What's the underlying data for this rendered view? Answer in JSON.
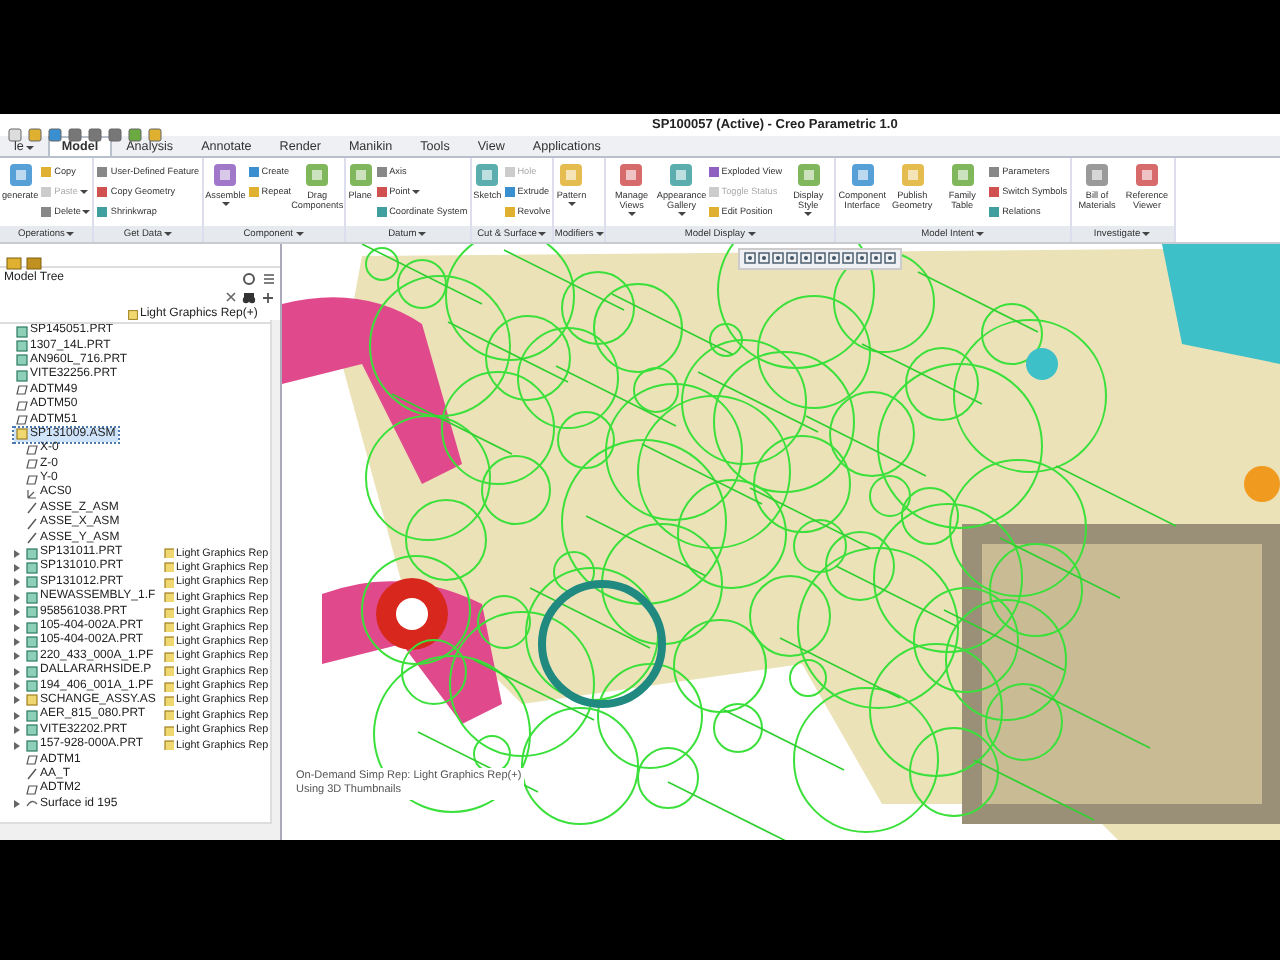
{
  "window": {
    "title": "SP100057 (Active) - Creo Parametric 1.0"
  },
  "tabs": [
    {
      "label": "le",
      "selected": false,
      "has_menu": true
    },
    {
      "label": "Model",
      "selected": true,
      "has_menu": false
    },
    {
      "label": "Analysis",
      "selected": false,
      "has_menu": false
    },
    {
      "label": "Annotate",
      "selected": false,
      "has_menu": false
    },
    {
      "label": "Render",
      "selected": false,
      "has_menu": false
    },
    {
      "label": "Manikin",
      "selected": false,
      "has_menu": false
    },
    {
      "label": "Tools",
      "selected": false,
      "has_menu": false
    },
    {
      "label": "View",
      "selected": false,
      "has_menu": false
    },
    {
      "label": "Applications",
      "selected": false,
      "has_menu": false
    }
  ],
  "ribbon": {
    "groups": [
      {
        "label": "Operations",
        "commands": [
          {
            "label": "generate",
            "kind": "big",
            "disabled": false,
            "has_menu": false
          },
          {
            "label": "Copy",
            "kind": "small",
            "disabled": false,
            "has_menu": false
          },
          {
            "label": "Paste",
            "kind": "small",
            "disabled": true,
            "has_menu": true
          },
          {
            "label": "Delete",
            "kind": "small",
            "disabled": false,
            "has_menu": true
          }
        ]
      },
      {
        "label": "Get Data",
        "commands": [
          {
            "label": "User-Defined Feature",
            "kind": "small",
            "disabled": false,
            "has_menu": false
          },
          {
            "label": "Copy Geometry",
            "kind": "small",
            "disabled": false,
            "has_menu": false
          },
          {
            "label": "Shrinkwrap",
            "kind": "small",
            "disabled": false,
            "has_menu": false
          }
        ]
      },
      {
        "label": "Component",
        "commands": [
          {
            "label": "Assemble",
            "kind": "big",
            "disabled": false,
            "has_menu": true
          },
          {
            "label": "Create",
            "kind": "small",
            "disabled": false,
            "has_menu": false
          },
          {
            "label": "Repeat",
            "kind": "small",
            "disabled": false,
            "has_menu": false
          },
          {
            "label": "Drag Components",
            "kind": "big",
            "disabled": false,
            "has_menu": false
          }
        ]
      },
      {
        "label": "Datum",
        "commands": [
          {
            "label": "Plane",
            "kind": "big",
            "disabled": false,
            "has_menu": false
          },
          {
            "label": "Axis",
            "kind": "small",
            "disabled": false,
            "has_menu": false
          },
          {
            "label": "Point",
            "kind": "small",
            "disabled": false,
            "has_menu": true
          },
          {
            "label": "Coordinate System",
            "kind": "small",
            "disabled": false,
            "has_menu": false
          }
        ]
      },
      {
        "label": "Cut & Surface",
        "commands": [
          {
            "label": "Sketch",
            "kind": "big",
            "disabled": false,
            "has_menu": false
          },
          {
            "label": "Hole",
            "kind": "small",
            "disabled": true,
            "has_menu": false
          },
          {
            "label": "Extrude",
            "kind": "small",
            "disabled": false,
            "has_menu": false
          },
          {
            "label": "Revolve",
            "kind": "small",
            "disabled": false,
            "has_menu": false
          }
        ]
      },
      {
        "label": "Modifiers",
        "commands": [
          {
            "label": "Pattern",
            "kind": "big",
            "disabled": false,
            "has_menu": true
          }
        ]
      },
      {
        "label": "Model Display",
        "commands": [
          {
            "label": "Manage Views",
            "kind": "big",
            "disabled": false,
            "has_menu": true
          },
          {
            "label": "Appearance Gallery",
            "kind": "big",
            "disabled": false,
            "has_menu": true
          },
          {
            "label": "Exploded View",
            "kind": "small",
            "disabled": false,
            "has_menu": false
          },
          {
            "label": "Toggle Status",
            "kind": "small",
            "disabled": true,
            "has_menu": false
          },
          {
            "label": "Edit Position",
            "kind": "small",
            "disabled": false,
            "has_menu": false
          },
          {
            "label": "Display Style",
            "kind": "big",
            "disabled": false,
            "has_menu": true
          }
        ]
      },
      {
        "label": "Model Intent",
        "commands": [
          {
            "label": "Component Interface",
            "kind": "big",
            "disabled": false,
            "has_menu": false
          },
          {
            "label": "Publish Geometry",
            "kind": "big",
            "disabled": false,
            "has_menu": false
          },
          {
            "label": "Family Table",
            "kind": "big",
            "disabled": false,
            "has_menu": false
          },
          {
            "label": "Parameters",
            "kind": "small",
            "disabled": false,
            "has_menu": false
          },
          {
            "label": "Switch Symbols",
            "kind": "small",
            "disabled": false,
            "has_menu": false
          },
          {
            "label": "Relations",
            "kind": "small",
            "disabled": false,
            "has_menu": false
          }
        ]
      },
      {
        "label": "Investigate",
        "commands": [
          {
            "label": "Bill of Materials",
            "kind": "big",
            "disabled": false,
            "has_menu": false
          },
          {
            "label": "Reference Viewer",
            "kind": "big",
            "disabled": false,
            "has_menu": false
          }
        ]
      }
    ]
  },
  "model_tree": {
    "title": "Model Tree",
    "column": "Light Graphics Rep(+)",
    "items": [
      {
        "label": "SP145051.PRT",
        "kind": "part",
        "expandable": false,
        "selected": false
      },
      {
        "label": "1307_14L.PRT",
        "kind": "part",
        "expandable": false,
        "selected": false
      },
      {
        "label": "AN960L_716.PRT",
        "kind": "part",
        "expandable": false,
        "selected": false
      },
      {
        "label": "VITE32256.PRT",
        "kind": "part",
        "expandable": false,
        "selected": false
      },
      {
        "label": "ADTM49",
        "kind": "plane",
        "expandable": false,
        "selected": false
      },
      {
        "label": "ADTM50",
        "kind": "plane",
        "expandable": false,
        "selected": false
      },
      {
        "label": "ADTM51",
        "kind": "plane",
        "expandable": false,
        "selected": false
      },
      {
        "label": "SP131009.ASM",
        "kind": "assembly",
        "expandable": false,
        "selected": true,
        "children": [
          {
            "label": "X-0",
            "kind": "plane",
            "expandable": false,
            "selected": false
          },
          {
            "label": "Z-0",
            "kind": "plane",
            "expandable": false,
            "selected": false
          },
          {
            "label": "Y-0",
            "kind": "plane",
            "expandable": false,
            "selected": false
          },
          {
            "label": "ACS0",
            "kind": "csys",
            "expandable": false,
            "selected": false
          },
          {
            "label": "ASSE_Z_ASM",
            "kind": "axis",
            "expandable": false,
            "selected": false
          },
          {
            "label": "ASSE_X_ASM",
            "kind": "axis",
            "expandable": false,
            "selected": false
          },
          {
            "label": "ASSE_Y_ASM",
            "kind": "axis",
            "expandable": false,
            "selected": false
          },
          {
            "label": "SP131011.PRT",
            "kind": "part",
            "expandable": true,
            "selected": false,
            "rep": "Light Graphics Rep"
          },
          {
            "label": "SP131010.PRT",
            "kind": "part",
            "expandable": true,
            "selected": false,
            "rep": "Light Graphics Rep"
          },
          {
            "label": "SP131012.PRT",
            "kind": "part",
            "expandable": true,
            "selected": false,
            "rep": "Light Graphics Rep"
          },
          {
            "label": "NEWASSEMBLY_1.F",
            "kind": "part",
            "expandable": true,
            "selected": false,
            "rep": "Light Graphics Rep"
          },
          {
            "label": "958561038.PRT",
            "kind": "part",
            "expandable": true,
            "selected": false,
            "rep": "Light Graphics Rep"
          },
          {
            "label": "105-404-002A.PRT",
            "kind": "part",
            "expandable": true,
            "selected": false,
            "rep": "Light Graphics Rep"
          },
          {
            "label": "105-404-002A.PRT",
            "kind": "part",
            "expandable": true,
            "selected": false,
            "rep": "Light Graphics Rep"
          },
          {
            "label": "220_433_000A_1.PF",
            "kind": "part",
            "expandable": true,
            "selected": false,
            "rep": "Light Graphics Rep"
          },
          {
            "label": "DALLARARHSIDE.P",
            "kind": "part",
            "expandable": true,
            "selected": false,
            "rep": "Light Graphics Rep"
          },
          {
            "label": "194_406_001A_1.PF",
            "kind": "part",
            "expandable": true,
            "selected": false,
            "rep": "Light Graphics Rep"
          },
          {
            "label": "SCHANGE_ASSY.AS",
            "kind": "assembly",
            "expandable": true,
            "selected": false,
            "rep": "Light Graphics Rep"
          },
          {
            "label": "AER_815_080.PRT",
            "kind": "part",
            "expandable": true,
            "selected": false,
            "rep": "Light Graphics Rep"
          },
          {
            "label": "VITE32202.PRT",
            "kind": "part",
            "expandable": true,
            "selected": false,
            "rep": "Light Graphics Rep"
          },
          {
            "label": "157-928-000A.PRT",
            "kind": "part",
            "expandable": true,
            "selected": false,
            "rep": "Light Graphics Rep"
          },
          {
            "label": "ADTM1",
            "kind": "plane",
            "expandable": false,
            "selected": false
          },
          {
            "label": "AA_T",
            "kind": "axis",
            "expandable": false,
            "selected": false
          },
          {
            "label": "ADTM2",
            "kind": "plane",
            "expandable": false,
            "selected": false
          },
          {
            "label": "Surface id 195",
            "kind": "surface",
            "expandable": true,
            "selected": false
          }
        ]
      }
    ]
  },
  "viewport": {
    "status_lines": [
      "On-Demand Simp Rep: Light Graphics Rep(+)",
      "Using 3D Thumbnails"
    ]
  }
}
